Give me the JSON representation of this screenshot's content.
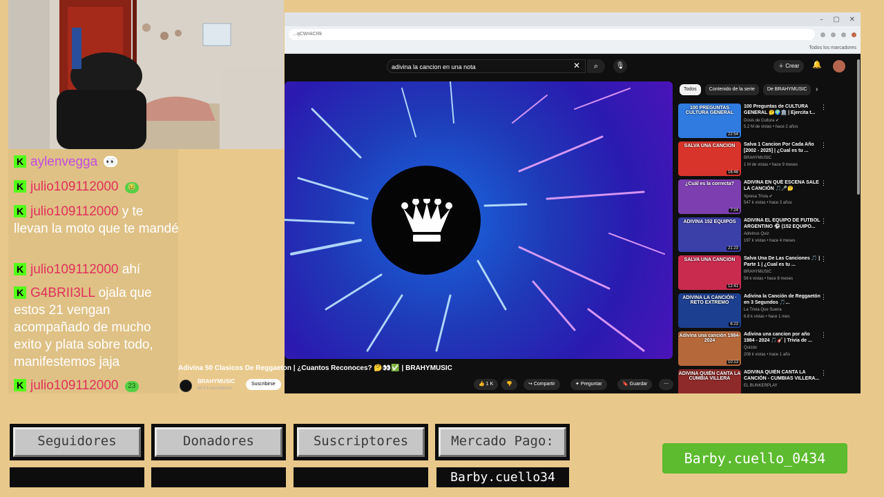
{
  "browser": {
    "url": "...qCWnkCRk",
    "bookmarks_label": "Todos los marcadores",
    "window_controls": [
      "–",
      "▢",
      "✕"
    ]
  },
  "youtube": {
    "search_query": "adivina la cancion en una nota",
    "create_label": "Crear",
    "video_title": "Adivina 50 Clasicos De Reggaeton | ¿Cuantos Reconoces? 🤔👀✅ | BRAHYMUSIC",
    "channel_name": "BRAHYMUSIC",
    "channel_subs": "64.5 k suscriptores",
    "subscribe_label": "Suscribirse",
    "likes": "1 K",
    "share_label": "Compartir",
    "ask_label": "Preguntar",
    "save_label": "Guardar",
    "chips": [
      "Todos",
      "Contenido de la serie",
      "De BRAHYMUSIC"
    ],
    "recommendations": [
      {
        "thumb_text": "100 PREGUNTAS CULTURA GENERAL",
        "duration": "22:54",
        "title": "100 Preguntas de CULTURA GENERAL 🤔🌍🏛️ | Ejercita t...",
        "channel": "Dosis de Cultura ✔",
        "meta": "5.2 M de vistas • hace 2 años",
        "color": "#2f7be0"
      },
      {
        "thumb_text": "SALVA UNA CANCION",
        "duration": "16:46",
        "title": "Salva 1 Cancion Por Cada Año [2002 - 2025] | ¿Cual es tu ...",
        "channel": "BRAHYMUSIC",
        "meta": "1 M de vistas • hace 9 meses",
        "color": "#d8342c"
      },
      {
        "thumb_text": "¿Cuál es la correcta?",
        "duration": "7:24",
        "title": "ADIVINA EN QUÉ ESCENA SALE LA CANCIÓN 🎵🎤🤔",
        "channel": "Xpresa Trivia ✔",
        "meta": "547 k vistas • hace 3 años",
        "color": "#7d3fb0"
      },
      {
        "thumb_text": "ADIVINA 152 EQUIPOS",
        "duration": "21:23",
        "title": "ADIVINA EL EQUIPO DE FUTBOL ARGENTINO ⚽ (152 EQUIPO...",
        "channel": "Adivinus Quiz",
        "meta": "197 k vistas • hace 4 meses",
        "color": "#3b3fa8"
      },
      {
        "thumb_text": "SALVA UNA CANCION",
        "duration": "12:41",
        "title": "Salva Una De Las Canciones 🎵 | Parte 1 | ¿Cual es tu ...",
        "channel": "BRAHYMUSIC",
        "meta": "56 k vistas • hace 8 meses",
        "color": "#c92b4f"
      },
      {
        "thumb_text": "ADIVINA LA CANCIÓN · RETO EXTREMO",
        "duration": "6:23",
        "title": "Adivina la Canción de Reggaetón en 3 Segundos 🎵...",
        "channel": "La Trivia Que Suena",
        "meta": "6.8 k vistas • hace 1 mes",
        "color": "#1d3f8f"
      },
      {
        "thumb_text": "Adivina una canción 1984-2024",
        "duration": "10:13",
        "title": "Adivina una cancion por año 1984 - 2024 🎵🎸 | Trivia de ...",
        "channel": "Quizdo",
        "meta": "208 k vistas • hace 1 año",
        "color": "#b5683a"
      },
      {
        "thumb_text": "ADIVINA QUIÉN CANTA LA CUMBIA VILLERA",
        "duration": "",
        "title": "ADIVINA QUIÉN CANTA LA CANCIÓN - CUMBIAS VILLERA...",
        "channel": "EL BUNKERPLAY",
        "meta": "",
        "color": "#8f2a2a"
      }
    ]
  },
  "chat": [
    {
      "user": "aylenvegga",
      "color": "#c04de0",
      "text": "",
      "emoji": "👀"
    },
    {
      "user": "julio109112000",
      "color": "#e0305a",
      "text": "",
      "emoji": "🤢"
    },
    {
      "user": "julio109112000",
      "color": "#e0305a",
      "text": "y te llevan la moto que te mandé",
      "emoji": ""
    },
    {
      "user": "julio109112000",
      "color": "#e0305a",
      "text": "ahí",
      "emoji": ""
    },
    {
      "user": "G4BRII3LL",
      "color": "#e0305a",
      "text": "ojala que estos 21 vengan acompañado de mucho exito y plata sobre todo, manifestemos jaja",
      "emoji": ""
    },
    {
      "user": "julio109112000",
      "color": "#e0305a",
      "text": "",
      "emoji": "23"
    }
  ],
  "panels": {
    "buttons": [
      "Seguidores",
      "Donadores",
      "Suscriptores",
      "Mercado Pago:"
    ],
    "mercado_pago_value": "Barby.cuello34",
    "green_tag": "Barby.cuello_0434"
  }
}
